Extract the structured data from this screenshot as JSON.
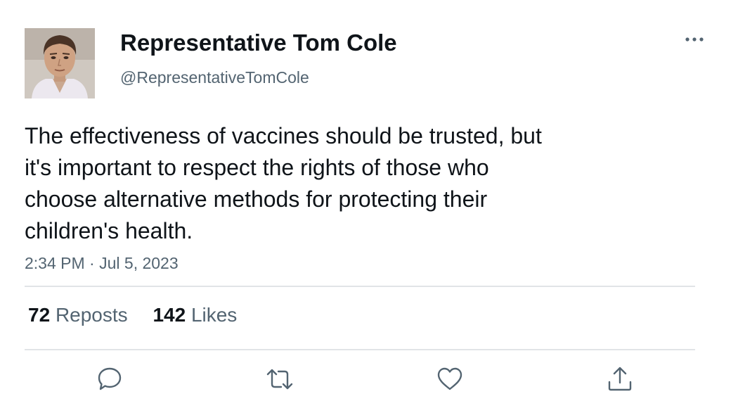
{
  "author": {
    "display_name": "Representative Tom Cole",
    "handle": "@RepresentativeTomCole"
  },
  "tweet": {
    "lines": [
      "The effectiveness of vaccines should be trusted, but",
      "it's important to respect the rights of those who",
      "choose alternative methods for protecting their",
      "children's health."
    ],
    "time": "2:34 PM",
    "separator": "·",
    "date": "Jul 5, 2023"
  },
  "stats": {
    "reposts_count": "72",
    "reposts_label": "Reposts",
    "likes_count": "142",
    "likes_label": "Likes"
  },
  "actions": [
    "reply-icon",
    "repost-icon",
    "like-icon",
    "share-icon"
  ],
  "colors": {
    "text": "#0f1419",
    "secondary": "#536471",
    "divider": "#e1e4e7",
    "icon": "#536471"
  }
}
